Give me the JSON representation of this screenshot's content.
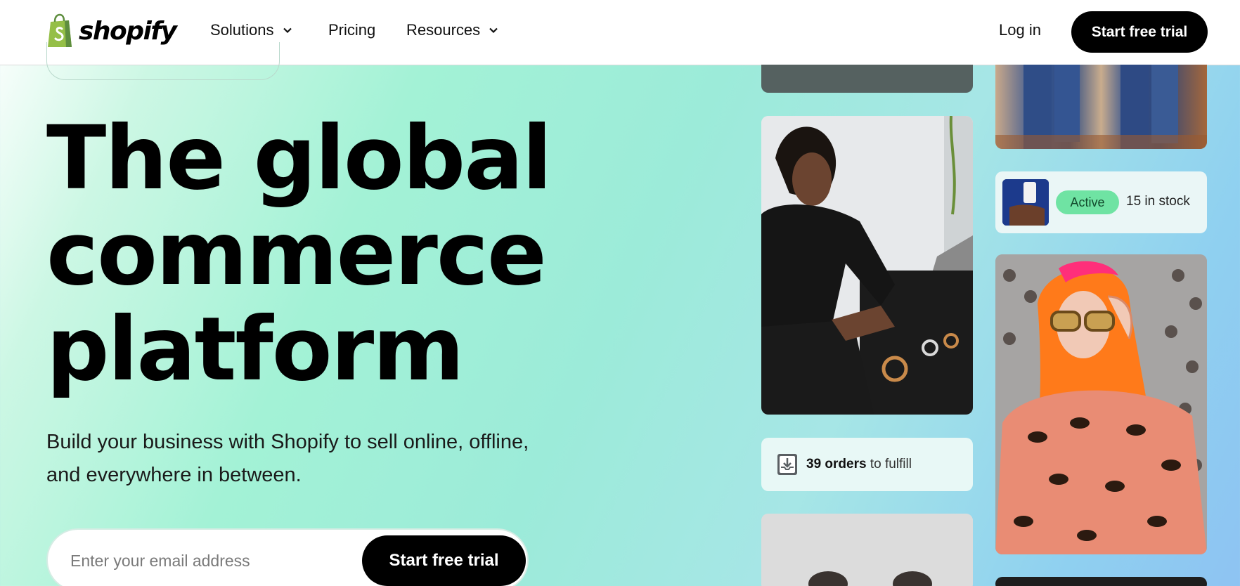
{
  "nav": {
    "brand": "shopify",
    "items": [
      {
        "label": "Solutions",
        "has_dropdown": true
      },
      {
        "label": "Pricing",
        "has_dropdown": false
      },
      {
        "label": "Resources",
        "has_dropdown": true
      }
    ],
    "login_label": "Log in",
    "cta_label": "Start free trial"
  },
  "hero": {
    "title_lines": [
      "The global",
      "commerce",
      "platform"
    ],
    "subtitle": "Build your business with Shopify to sell online, offline, and everywhere in between.",
    "email_placeholder": "Enter your email address",
    "cta_label": "Start free trial"
  },
  "cards": {
    "stock_badge": "Active",
    "stock_count": "15 in stock",
    "orders_count": "39 orders",
    "orders_suffix": " to fulfill"
  },
  "colors": {
    "brand_green": "#95BF47",
    "badge_green": "#6FE3A3",
    "cta_black": "#000000"
  }
}
